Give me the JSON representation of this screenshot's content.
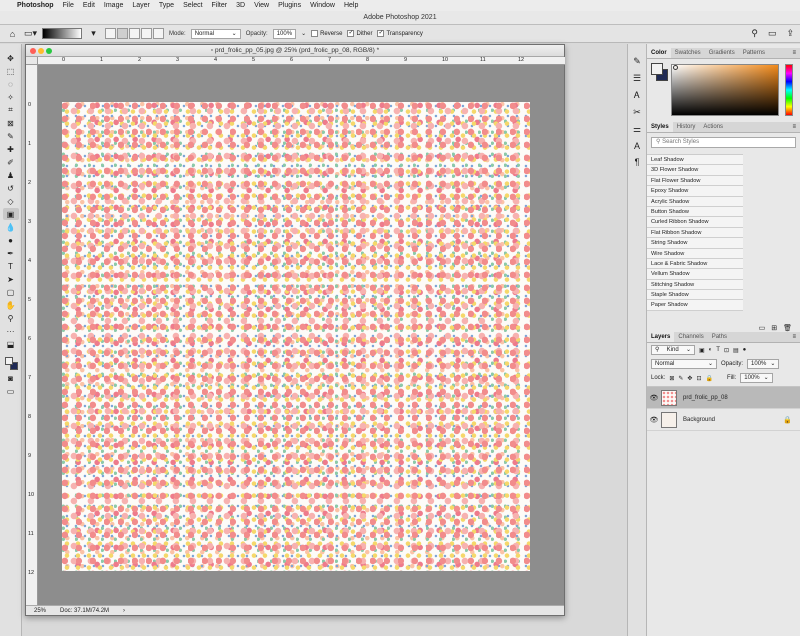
{
  "menubar": {
    "app_name": "Photoshop",
    "items": [
      "File",
      "Edit",
      "Image",
      "Layer",
      "Type",
      "Select",
      "Filter",
      "3D",
      "View",
      "Plugins",
      "Window",
      "Help"
    ]
  },
  "window": {
    "title": "Adobe Photoshop 2021"
  },
  "options": {
    "mode_label": "Mode:",
    "mode_value": "Normal",
    "opacity_label": "Opacity:",
    "opacity_value": "100%",
    "reverse_label": "Reverse",
    "dither_label": "Dither",
    "transparency_label": "Transparency",
    "reverse_checked": false,
    "dither_checked": true,
    "transparency_checked": true
  },
  "document": {
    "tab_title": "prd_frolic_pp_05.jpg @ 25% (prd_frolic_pp_08, RGB/8) *",
    "ruler_top": [
      "0",
      "1",
      "2",
      "3",
      "4",
      "5",
      "6",
      "7",
      "8",
      "9",
      "10",
      "11",
      "12"
    ],
    "ruler_left": [
      "0",
      "1",
      "2",
      "3",
      "4",
      "5",
      "6",
      "7",
      "8",
      "9",
      "10",
      "11",
      "12"
    ],
    "zoom": "25%",
    "doc_size": "Doc: 37.1M/74.2M"
  },
  "color_panel": {
    "tabs": [
      "Color",
      "Swatches",
      "Gradients",
      "Patterns"
    ],
    "foreground": "#f2f2f2",
    "background": "#1f2a55"
  },
  "styles_panel": {
    "tabs": [
      "Styles",
      "History",
      "Actions"
    ],
    "search_placeholder": "Search Styles",
    "items": [
      "Leaf Shadow",
      "3D Flower Shadow",
      "Flat Flower Shadow",
      "Epoxy Shadow",
      "Acrylic Shadow",
      "Button Shadow",
      "Curled Ribbon Shadow",
      "Flat Ribbon Shadow",
      "String Shadow",
      "Wire Shadow",
      "Lace & Fabric Shadow",
      "Vellum Shadow",
      "Stitching Shadow",
      "Staple Shadow",
      "Paper Shadow"
    ]
  },
  "layers_panel": {
    "tabs": [
      "Layers",
      "Channels",
      "Paths"
    ],
    "filter_value": "Kind",
    "blend_mode": "Normal",
    "opacity_label": "Opacity:",
    "opacity_value": "100%",
    "lock_label": "Lock:",
    "fill_label": "Fill:",
    "fill_value": "100%",
    "layers": [
      {
        "name": "prd_frolic_pp_08",
        "selected": true
      },
      {
        "name": "Background",
        "selected": false
      }
    ]
  }
}
